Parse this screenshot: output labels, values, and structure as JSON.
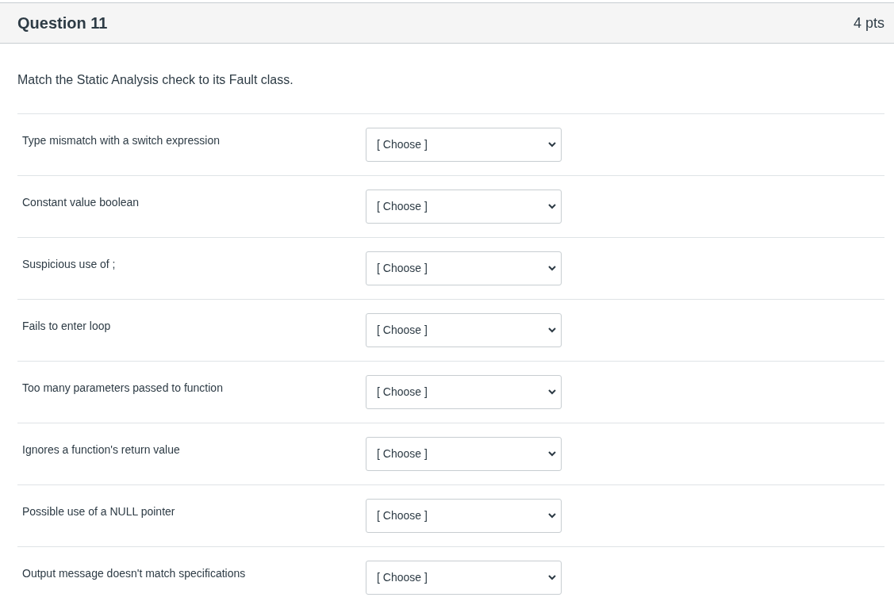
{
  "question": {
    "title": "Question 11",
    "points": "4 pts"
  },
  "prompt": "Match the Static Analysis check to its Fault class.",
  "matches": [
    {
      "label": "Type mismatch with a switch expression",
      "value": "[ Choose ]"
    },
    {
      "label": "Constant value boolean",
      "value": "[ Choose ]"
    },
    {
      "label": "Suspicious use of ;",
      "value": "[ Choose ]"
    },
    {
      "label": "Fails to enter loop",
      "value": "[ Choose ]"
    },
    {
      "label": "Too many parameters passed to function",
      "value": "[ Choose ]"
    },
    {
      "label": "Ignores a function's return value",
      "value": "[ Choose ]"
    },
    {
      "label": "Possible use of a NULL pointer",
      "value": "[ Choose ]"
    },
    {
      "label": "Output message doesn't match specifications",
      "value": "[ Choose ]"
    }
  ]
}
